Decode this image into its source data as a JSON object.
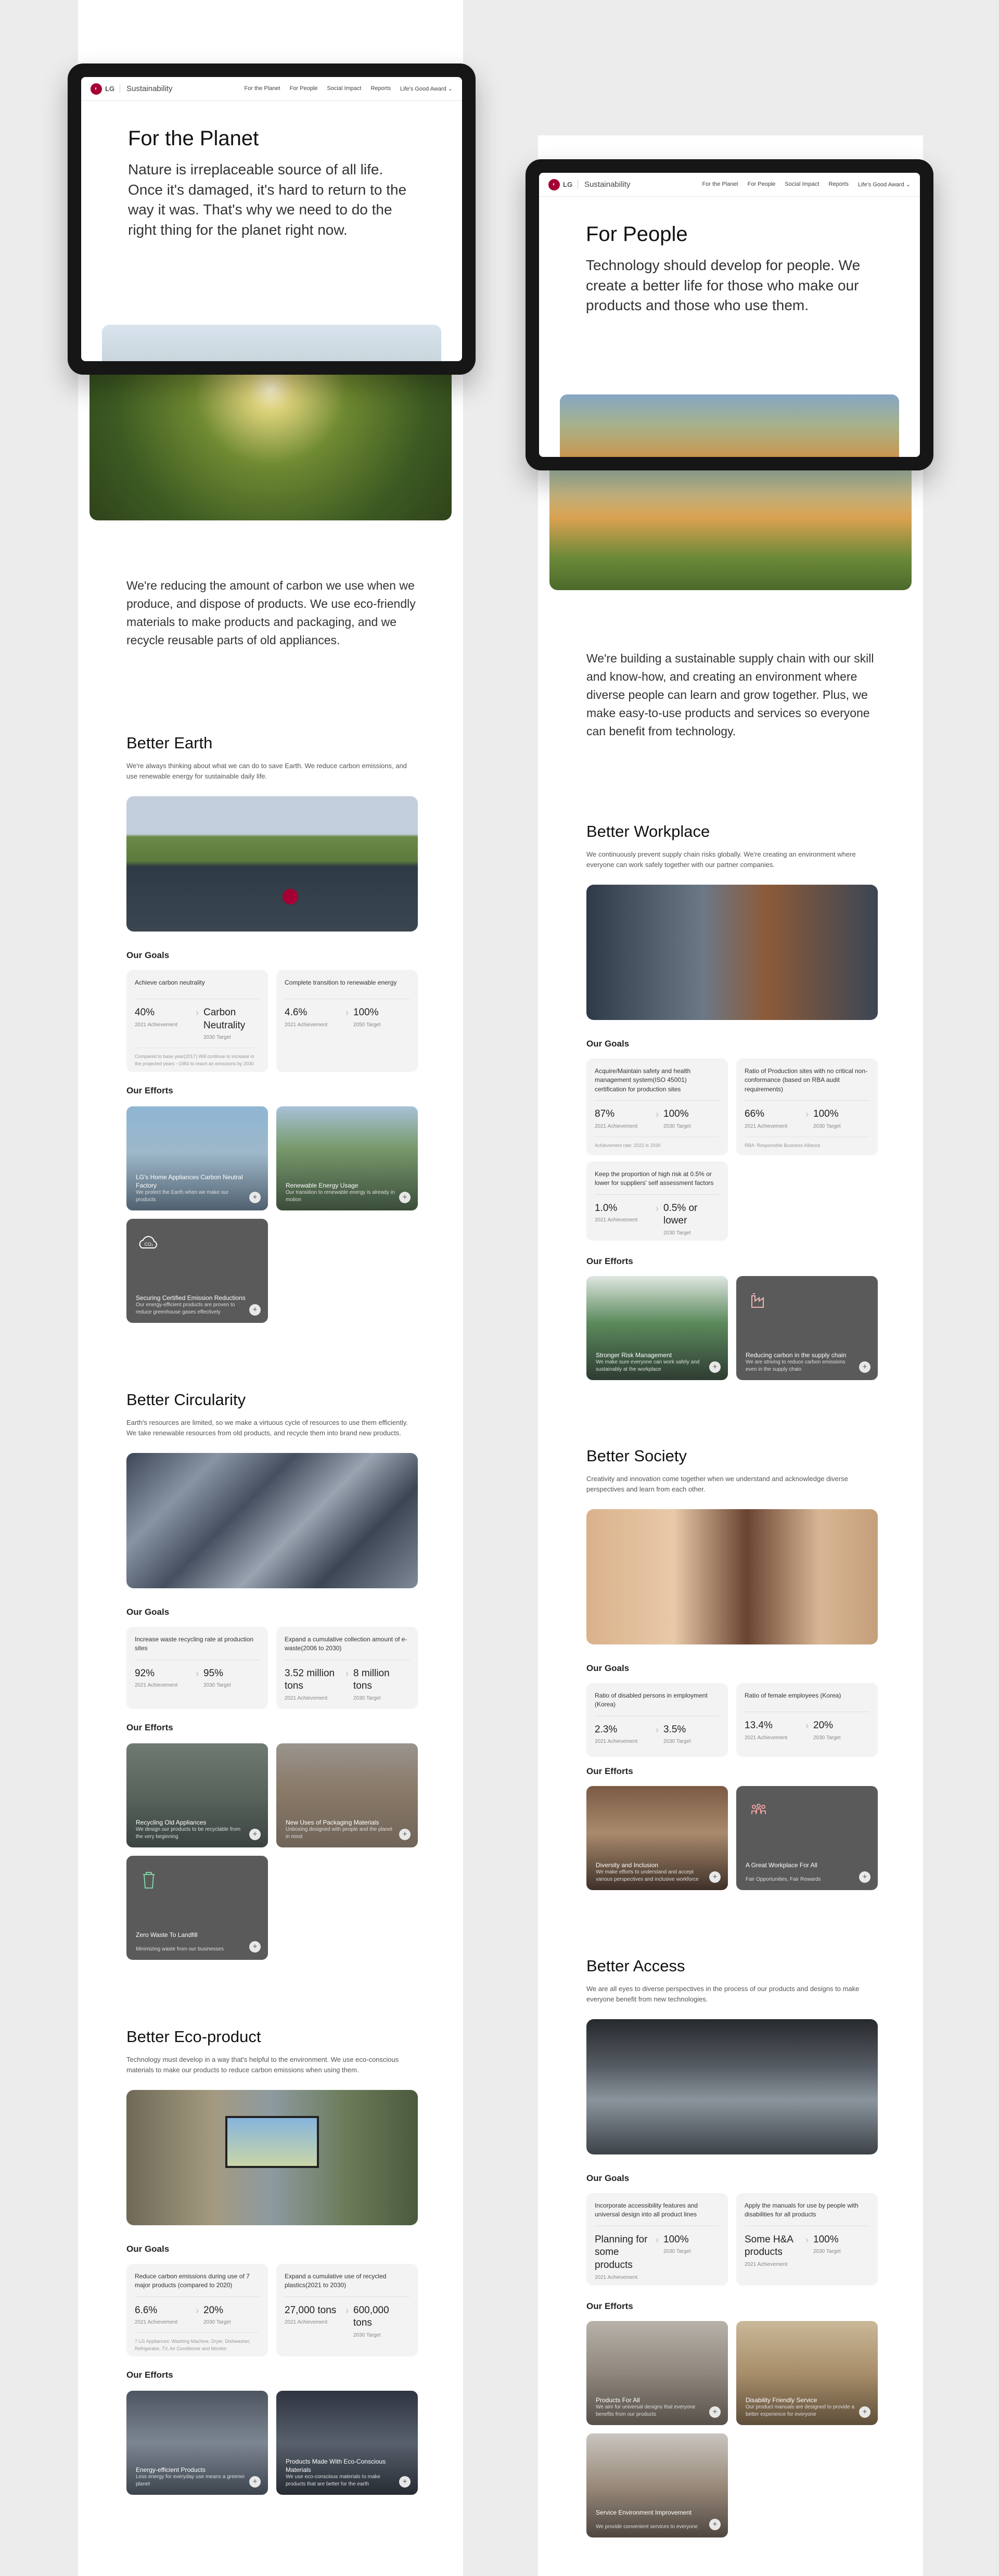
{
  "nav": {
    "logo": "LG",
    "brand": "Sustainability",
    "items": [
      "For the Planet",
      "For People",
      "Social Impact",
      "Reports",
      "Life's Good Award ⌄"
    ]
  },
  "planet": {
    "title": "For the Planet",
    "hero_text": "Nature is irreplaceable source of all life. Once it's damaged, it's hard to return to the way it was. That's why we need to do the right thing for the planet right now.",
    "intro": "We're reducing the amount of carbon we use when we produce, and dispose of products. We use eco-friendly materials to make products and packaging, and we recycle reusable parts of old appliances.",
    "earth": {
      "title": "Better Earth",
      "desc": "We're always thinking about what we can do to save Earth. We reduce carbon emissions, and use renewable energy for sustainable daily life.",
      "goals_label": "Our Goals",
      "goals": [
        {
          "title": "Achieve carbon neutrality",
          "from": "40%",
          "from_label": "2021 Achievement",
          "to": "Carbon Neutrality",
          "to_label": "2030 Target",
          "note": "Compared to base year(2017)  Will continue to increase in the projected years ~1984 to reach an emissions by 2030"
        },
        {
          "title": "Complete transition to renewable energy",
          "from": "4.6%",
          "from_label": "2021 Achievement",
          "to": "100%",
          "to_label": "2050 Target",
          "note": ""
        }
      ],
      "efforts_label": "Our Efforts",
      "efforts": [
        {
          "title": "LG's Home Appliances Carbon Neutral Factory",
          "desc": "We protect the Earth when we make our products"
        },
        {
          "title": "Renewable Energy Usage",
          "desc": "Our transition to renewable energy is already in motion"
        },
        {
          "title": "Securing Certified Emission Reductions",
          "desc": "Our energy-efficient products are proven to reduce greenhouse gases effectively"
        }
      ]
    },
    "circularity": {
      "title": "Better Circularity",
      "desc": "Earth's resources are limited, so we make a virtuous cycle of resources to use them efficiently. We take renewable resources from old products, and recycle them into brand new products.",
      "goals_label": "Our Goals",
      "goals": [
        {
          "title": "Increase waste recycling rate at production sites",
          "from": "92%",
          "from_label": "2021 Achievement",
          "to": "95%",
          "to_label": "2030 Target"
        },
        {
          "title": "Expand a cumulative collection amount of e-waste(2006 to 2030)",
          "from": "3.52 million tons",
          "from_label": "2021 Achievement",
          "to": "8 million tons",
          "to_label": "2030 Target"
        }
      ],
      "efforts_label": "Our Efforts",
      "efforts": [
        {
          "title": "Recycling Old Appliances",
          "desc": "We design our products to be recyclable from the very beginning"
        },
        {
          "title": "New Uses of Packaging Materials",
          "desc": "Unboxing designed with people and the planet in mind"
        },
        {
          "title": "Zero Waste To Landfill",
          "desc": "Minimizing waste from our businesses"
        }
      ]
    },
    "eco": {
      "title": "Better Eco-product",
      "desc": "Technology must develop in a way that's helpful to the environment. We use eco-conscious materials to make our products to reduce carbon emissions when using them.",
      "goals_label": "Our Goals",
      "goals": [
        {
          "title": "Reduce carbon emissions during use of 7 major products (compared to 2020)",
          "from": "6.6%",
          "from_label": "2021 Achievement",
          "to": "20%",
          "to_label": "2030 Target",
          "note": "7 LG Appliances: Washing Machine, Dryer, Dishwasher, Refrigerator, TV, Air Conditioner and Monitor"
        },
        {
          "title": "Expand a cumulative use of recycled plastics(2021 to 2030)",
          "from": "27,000 tons",
          "from_label": "2021 Achievement",
          "to": "600,000 tons",
          "to_label": "2030 Target"
        }
      ],
      "efforts_label": "Our Efforts",
      "efforts": [
        {
          "title": "Energy-efficient Products",
          "desc": "Less energy for everyday use means a greener planet"
        },
        {
          "title": "Products Made With Eco-Conscious Materials",
          "desc": "We use eco-conscious materials to make products that are better for the earth"
        }
      ]
    }
  },
  "people": {
    "title": "For People",
    "hero_text": "Technology should develop for people. We create a better life for those who make our products and those who use them.",
    "intro": "We're building a sustainable supply chain with our skill and know-how, and creating an environment where diverse people can learn and grow together. Plus, we make easy-to-use products and services so everyone can benefit from technology.",
    "workplace": {
      "title": "Better Workplace",
      "desc": "We continuously prevent supply chain risks globally. We're creating an environment where everyone can work safely together with our partner companies.",
      "goals_label": "Our Goals",
      "goals": [
        {
          "title": "Acquire/Maintain safety and health management system(ISO 45001) certification for production sites",
          "from": "87%",
          "from_label": "2021 Achievement",
          "to": "100%",
          "to_label": "2030 Target",
          "note": "Achievement rate: 2022 is 2030"
        },
        {
          "title": "Ratio of Production sites with no critical non-conformance (based on RBA audit requirements)",
          "from": "66%",
          "from_label": "2021 Achievement",
          "to": "100%",
          "to_label": "2030 Target",
          "note": "RBA: Responsible Business Alliance"
        },
        {
          "title": "Keep the proportion of high risk at 0.5% or lower for suppliers' self assessment factors",
          "from": "1.0%",
          "from_label": "2021 Achievement",
          "to": "0.5% or lower",
          "to_label": "2030 Target"
        }
      ],
      "efforts_label": "Our Efforts",
      "efforts": [
        {
          "title": "Stronger Risk Management",
          "desc": "We make sure everyone can work safely and sustainably at the workplace"
        },
        {
          "title": "Reducing carbon in the supply chain",
          "desc": "We are striving to reduce carbon emissions even in the supply chain"
        }
      ]
    },
    "society": {
      "title": "Better Society",
      "desc": "Creativity and innovation come together when we understand and acknowledge diverse perspectives and learn from each other.",
      "goals_label": "Our Goals",
      "goals": [
        {
          "title": "Ratio of disabled persons in employment (Korea)",
          "from": "2.3%",
          "from_label": "2021 Achievement",
          "to": "3.5%",
          "to_label": "2030 Target"
        },
        {
          "title": "Ratio of female employees (Korea)",
          "from": "13.4%",
          "from_label": "2021 Achievement",
          "to": "20%",
          "to_label": "2030 Target"
        }
      ],
      "efforts_label": "Our Efforts",
      "efforts": [
        {
          "title": "Diversity and Inclusion",
          "desc": "We make efforts to understand and accept various perspectives and inclusive workforce"
        },
        {
          "title": "A Great Workplace For All",
          "desc": "Fair Opportunities, Fair Rewards"
        }
      ]
    },
    "access": {
      "title": "Better Access",
      "desc": "We are all eyes to diverse perspectives in the process of our products and designs to make everyone benefit from new technologies.",
      "goals_label": "Our Goals",
      "goals": [
        {
          "title": "Incorporate accessibility features and universal design into all product lines",
          "from": "Planning for some products",
          "from_label": "2021 Achievement",
          "to": "100%",
          "to_label": "2030 Target"
        },
        {
          "title": "Apply the manuals for use by people with disabilities for all products",
          "from": "Some H&A products",
          "from_label": "2021 Achievement",
          "to": "100%",
          "to_label": "2030 Target"
        }
      ],
      "efforts_label": "Our Efforts",
      "efforts": [
        {
          "title": "Products For All",
          "desc": "We aim for universal designs that everyone benefits from our products"
        },
        {
          "title": "Disability Friendly Service",
          "desc": "Our product manuals are designed to provide a better experience for everyone"
        },
        {
          "title": "Service Environment Improvement",
          "desc": "We provide convenient services to everyone"
        }
      ]
    }
  },
  "colors": {
    "lg_red": "#a50034",
    "card_bg": "#f3f3f3",
    "effort_dark": "#5a5a5a"
  }
}
